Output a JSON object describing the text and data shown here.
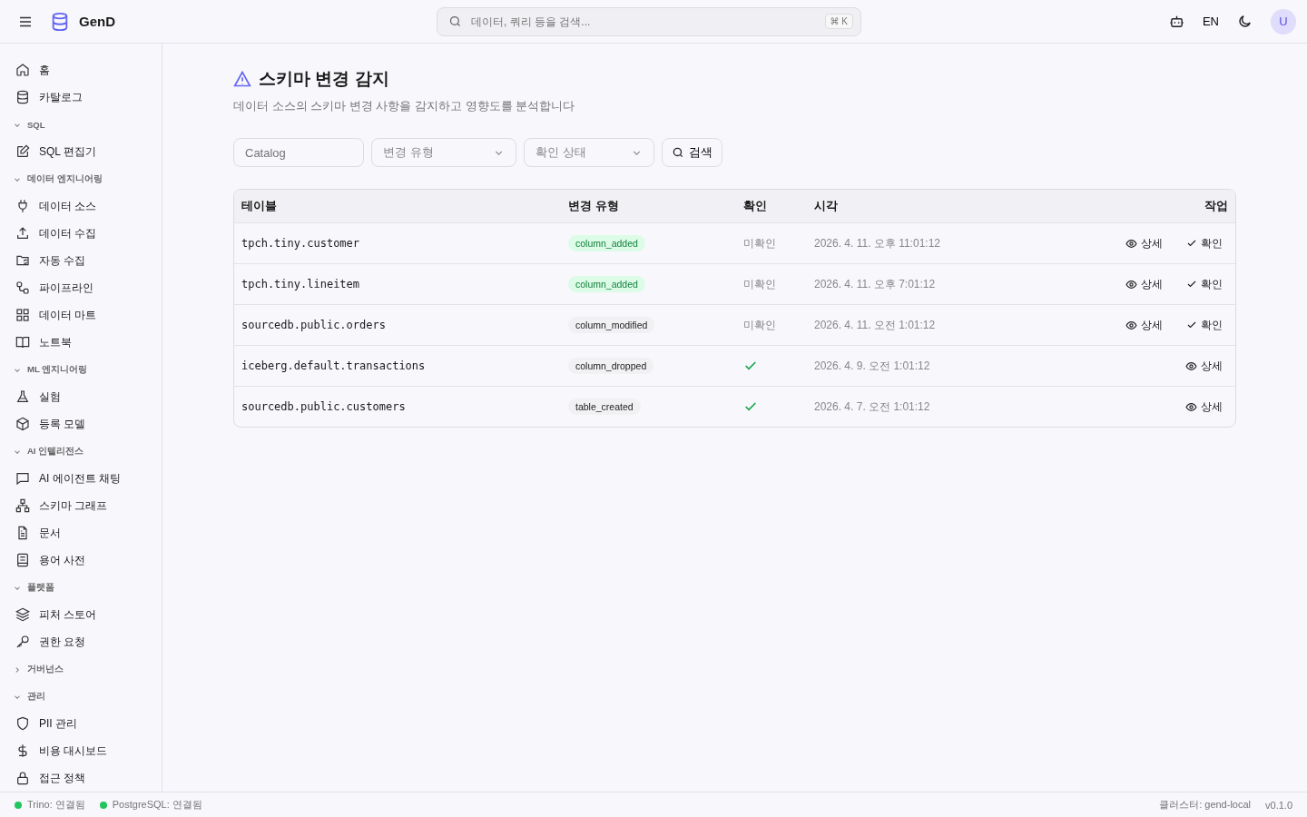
{
  "header": {
    "app_name": "GenD",
    "search": {
      "placeholder": "데이터, 쿼리 등을 검색...",
      "shortcut": "⌘ K"
    },
    "language": "EN",
    "avatar": "U"
  },
  "sidebar": {
    "items": [
      {
        "label": "홈"
      },
      {
        "label": "카탈로그"
      }
    ],
    "sections": [
      {
        "title": "SQL",
        "expanded": true,
        "items": [
          {
            "label": "SQL 편집기"
          }
        ]
      },
      {
        "title": "데이터 엔지니어링",
        "expanded": true,
        "items": [
          {
            "label": "데이터 소스"
          },
          {
            "label": "데이터 수집"
          },
          {
            "label": "자동 수집"
          },
          {
            "label": "파이프라인"
          },
          {
            "label": "데이터 마트"
          },
          {
            "label": "노트북"
          }
        ]
      },
      {
        "title": "ML 엔지니어링",
        "expanded": true,
        "items": [
          {
            "label": "실험"
          },
          {
            "label": "등록 모델"
          }
        ]
      },
      {
        "title": "AI 인텔리전스",
        "expanded": true,
        "items": [
          {
            "label": "AI 에이전트 채팅"
          },
          {
            "label": "스키마 그래프"
          },
          {
            "label": "문서"
          },
          {
            "label": "용어 사전"
          }
        ]
      },
      {
        "title": "플랫폼",
        "expanded": true,
        "items": [
          {
            "label": "피처 스토어"
          },
          {
            "label": "권한 요청"
          }
        ]
      },
      {
        "title": "거버넌스",
        "expanded": false
      },
      {
        "title": "관리",
        "expanded": true,
        "items": [
          {
            "label": "PII 관리"
          },
          {
            "label": "비용 대시보드"
          },
          {
            "label": "접근 정책"
          }
        ]
      }
    ]
  },
  "page": {
    "title": "스키마 변경 감지",
    "subtitle": "데이터 소스의 스키마 변경 사항을 감지하고 영향도를 분석합니다"
  },
  "filters": {
    "catalog": {
      "placeholder": "Catalog"
    },
    "change_type": {
      "placeholder": "변경 유형"
    },
    "status": {
      "placeholder": "확인 상태"
    },
    "search_button": "검색"
  },
  "table": {
    "columns": [
      "테이블",
      "변경 유형",
      "확인",
      "시각",
      "작업"
    ],
    "rows": [
      {
        "table": "tpch.tiny.customer",
        "change_type": "column_added",
        "color": "#dcfce7",
        "confirmed": false,
        "status_text": "미확인",
        "time": "2026. 4. 11. 오후 11:01:12",
        "actions": [
          "상세",
          "확인"
        ]
      },
      {
        "table": "tpch.tiny.lineitem",
        "change_type": "column_added",
        "color": "#dcfce7",
        "confirmed": false,
        "status_text": "미확인",
        "time": "2026. 4. 11. 오후 7:01:12",
        "actions": [
          "상세",
          "확인"
        ]
      },
      {
        "table": "sourcedb.public.orders",
        "change_type": "column_modified",
        "color": "#f1f1f4",
        "confirmed": false,
        "status_text": "미확인",
        "time": "2026. 4. 11. 오전 1:01:12",
        "actions": [
          "상세",
          "확인"
        ]
      },
      {
        "table": "iceberg.default.transactions",
        "change_type": "column_dropped",
        "color": "#f1f1f4",
        "confirmed": true,
        "time": "2026. 4. 9. 오전 1:01:12",
        "actions": [
          "상세"
        ]
      },
      {
        "table": "sourcedb.public.customers",
        "change_type": "table_created",
        "color": "#f1f1f4",
        "confirmed": true,
        "time": "2026. 4. 7. 오전 1:01:12",
        "actions": [
          "상세"
        ]
      }
    ]
  },
  "status_bar": {
    "connections": [
      {
        "label": "Trino: 연결됨",
        "color": "#22c55e"
      },
      {
        "label": "PostgreSQL: 연결됨",
        "color": "#22c55e"
      }
    ],
    "cluster": "클러스터: gend-local",
    "version": "v0.1.0"
  }
}
